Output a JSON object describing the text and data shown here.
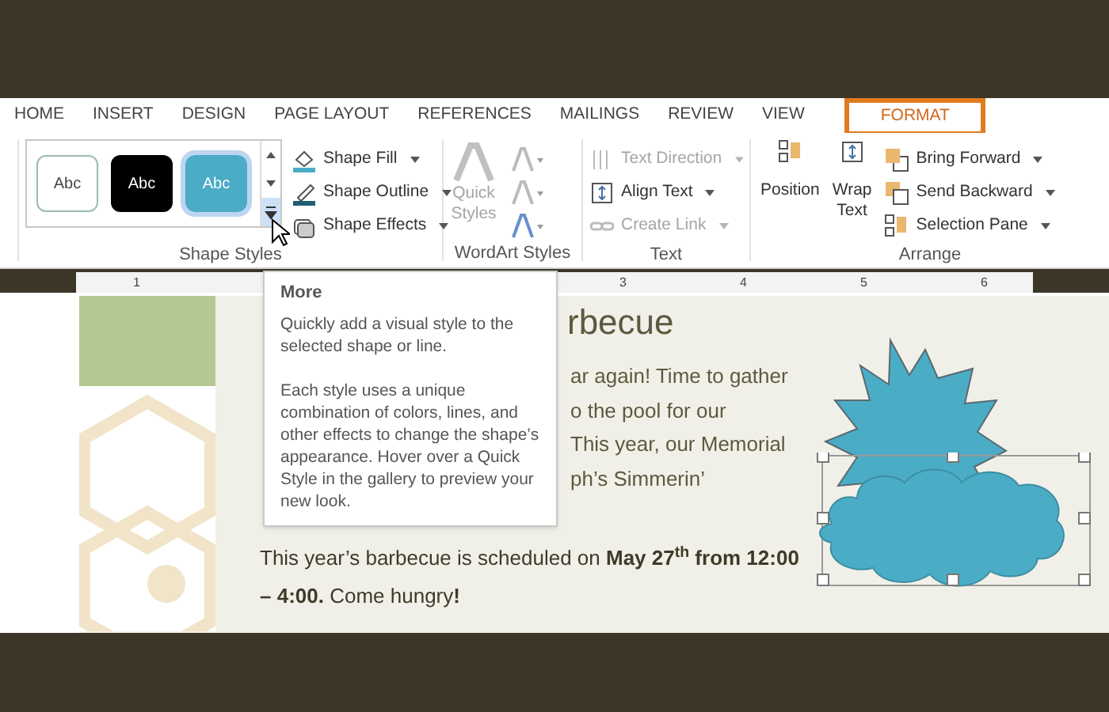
{
  "tabs": [
    {
      "label": "HOME",
      "selected": false
    },
    {
      "label": "INSERT",
      "selected": false
    },
    {
      "label": "DESIGN",
      "selected": false
    },
    {
      "label": "PAGE LAYOUT",
      "selected": false
    },
    {
      "label": "REFERENCES",
      "selected": false
    },
    {
      "label": "MAILINGS",
      "selected": false
    },
    {
      "label": "REVIEW",
      "selected": false
    },
    {
      "label": "VIEW",
      "selected": false
    },
    {
      "label": "FORMAT",
      "selected": true
    }
  ],
  "shape_styles": {
    "label": "Shape Styles",
    "gallery": [
      {
        "label": "Abc",
        "color": "#ffffff",
        "selected": false
      },
      {
        "label": "Abc",
        "color": "#000000",
        "selected": false
      },
      {
        "label": "Abc",
        "color": "#4bacc6",
        "selected": true
      }
    ],
    "commands": [
      {
        "label": "Shape Fill"
      },
      {
        "label": "Shape Outline"
      },
      {
        "label": "Shape Effects"
      }
    ]
  },
  "wordart_styles": {
    "label": "WordArt Styles",
    "quick_styles": [
      "Quick",
      "Styles"
    ],
    "disabled": true
  },
  "text_group": {
    "label": "Text",
    "commands": [
      {
        "label": "Text Direction",
        "disabled": true
      },
      {
        "label": "Align Text",
        "disabled": false
      },
      {
        "label": "Create Link",
        "disabled": true
      }
    ]
  },
  "arrange": {
    "label": "Arrange",
    "large": [
      [
        "Position"
      ],
      [
        "Wrap",
        "Text"
      ]
    ],
    "commands": [
      {
        "label": "Bring Forward"
      },
      {
        "label": "Send Backward"
      },
      {
        "label": "Selection Pane"
      }
    ]
  },
  "ruler": [
    "1",
    "3",
    "4",
    "5",
    "6"
  ],
  "document": {
    "title": "rbecue",
    "lines": [
      "ar again! Time to gather",
      "o the pool for our",
      "This year, our Memorial",
      "ph’s Simmerin’"
    ],
    "paragraph": "This year’s barbecue is scheduled on **May 27$^{th}$ from 12:00 – 4:00.** Come hungry**!**"
  },
  "tooltip": {
    "title": "More",
    "paragraphs": [
      "Quickly add a visual style to the selected shape or line.",
      "Each style uses a unique combination of colors, lines, and other effects to change the shape’s appearance. Hover over a Quick Style in the gallery to preview your new look."
    ]
  }
}
